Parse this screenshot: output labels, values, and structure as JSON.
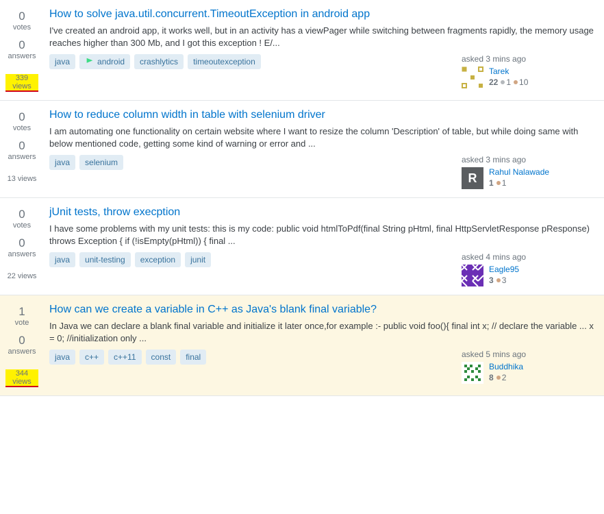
{
  "questions": [
    {
      "votes": 0,
      "votes_label": "votes",
      "answers": 0,
      "answers_label": "answers",
      "views": "339 views",
      "views_marked": true,
      "title": "How to solve java.util.concurrent.TimeoutException in android app",
      "excerpt": "I've created an android app, it works well, but in an activity has a viewPager while switching between fragments rapidly, the memory usage reaches higher than 300 Mb, and I got this exception ! E/...",
      "tags": [
        {
          "name": "java"
        },
        {
          "name": "android",
          "icon": true
        },
        {
          "name": "crashlytics"
        },
        {
          "name": "timeoutexception"
        }
      ],
      "asked": "asked 3 mins ago",
      "user": {
        "name": "Tarek",
        "rep": "22",
        "silver": 1,
        "bronze": 10,
        "avatar": "tarek"
      }
    },
    {
      "votes": 0,
      "votes_label": "votes",
      "answers": 0,
      "answers_label": "answers",
      "views": "13 views",
      "views_marked": false,
      "title": "How to reduce column width in table with selenium driver",
      "excerpt": "I am automating one functionality on certain website where I want to resize the column 'Description' of table, but while doing same with below mentioned code, getting some kind of warning or error and ...",
      "tags": [
        {
          "name": "java"
        },
        {
          "name": "selenium"
        }
      ],
      "asked": "asked 3 mins ago",
      "user": {
        "name": "Rahul Nalawade",
        "rep": "1",
        "bronze": 1,
        "avatar": "rahul"
      }
    },
    {
      "votes": 0,
      "votes_label": "votes",
      "answers": 0,
      "answers_label": "answers",
      "views": "22 views",
      "views_marked": false,
      "title": "jUnit tests, throw execption",
      "excerpt": "I have some problems with my unit tests: this is my code: public void htmlToPdf(final String pHtml, final HttpServletResponse pResponse) throws Exception { if (!isEmpty(pHtml)) { final ...",
      "tags": [
        {
          "name": "java"
        },
        {
          "name": "unit-testing"
        },
        {
          "name": "exception"
        },
        {
          "name": "junit"
        }
      ],
      "asked": "asked 4 mins ago",
      "user": {
        "name": "Eagle95",
        "rep": "3",
        "bronze": 3,
        "avatar": "eagle"
      }
    },
    {
      "votes": 1,
      "votes_label": "vote",
      "answers": 0,
      "answers_label": "answers",
      "views": "344 views",
      "views_marked": true,
      "highlighted": true,
      "title": "How can we create a variable in C++ as Java's blank final variable?",
      "excerpt": "In Java we can declare a blank final variable and initialize it later once,for example :- public void foo(){ final int x; // declare the variable ... x = 0; //initialization only ...",
      "tags": [
        {
          "name": "java"
        },
        {
          "name": "c++"
        },
        {
          "name": "c++11"
        },
        {
          "name": "const"
        },
        {
          "name": "final"
        }
      ],
      "asked": "asked 5 mins ago",
      "user": {
        "name": "Buddhika",
        "rep": "8",
        "bronze": 2,
        "avatar": "buddhika"
      }
    }
  ]
}
